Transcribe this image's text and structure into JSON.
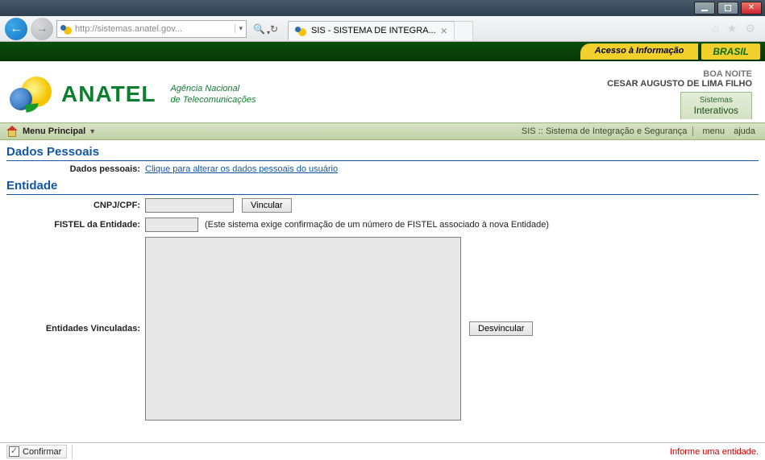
{
  "window": {
    "url": "http://sistemas.anatel.gov...",
    "tab_title": "SIS - SISTEMA DE INTEGRA..."
  },
  "govbar": {
    "access_info": "Acesso à Informação",
    "brazil": "BRASIL"
  },
  "header": {
    "logo_text": "ANATEL",
    "slogan_line1": "Agência Nacional",
    "slogan_line2": "de Telecomunicações",
    "greeting": "BOA NOITE",
    "username": "CESAR AUGUSTO DE LIMA FILHO",
    "tab_line1": "Sistemas",
    "tab_line2": "Interativos"
  },
  "menubar": {
    "main": "Menu Principal",
    "crumb": "SIS :: Sistema de Integração e Segurança",
    "menu": "menu",
    "ajuda": "ajuda"
  },
  "sections": {
    "dados_pessoais_title": "Dados Pessoais",
    "dados_pessoais_label": "Dados pessoais:",
    "dados_pessoais_link": "Clique para alterar os dados pessoais do usuário",
    "entidade_title": "Entidade",
    "cnpj_label": "CNPJ/CPF:",
    "vincular_btn": "Vincular",
    "fistel_label": "FISTEL da Entidade:",
    "fistel_hint": "(Este sistema exige confirmação de um número de FISTEL associado à nova Entidade)",
    "entidades_label": "Entidades Vinculadas:",
    "desvincular_btn": "Desvincular"
  },
  "footer": {
    "confirm": "Confirmar",
    "error": "Informe uma entidade."
  }
}
